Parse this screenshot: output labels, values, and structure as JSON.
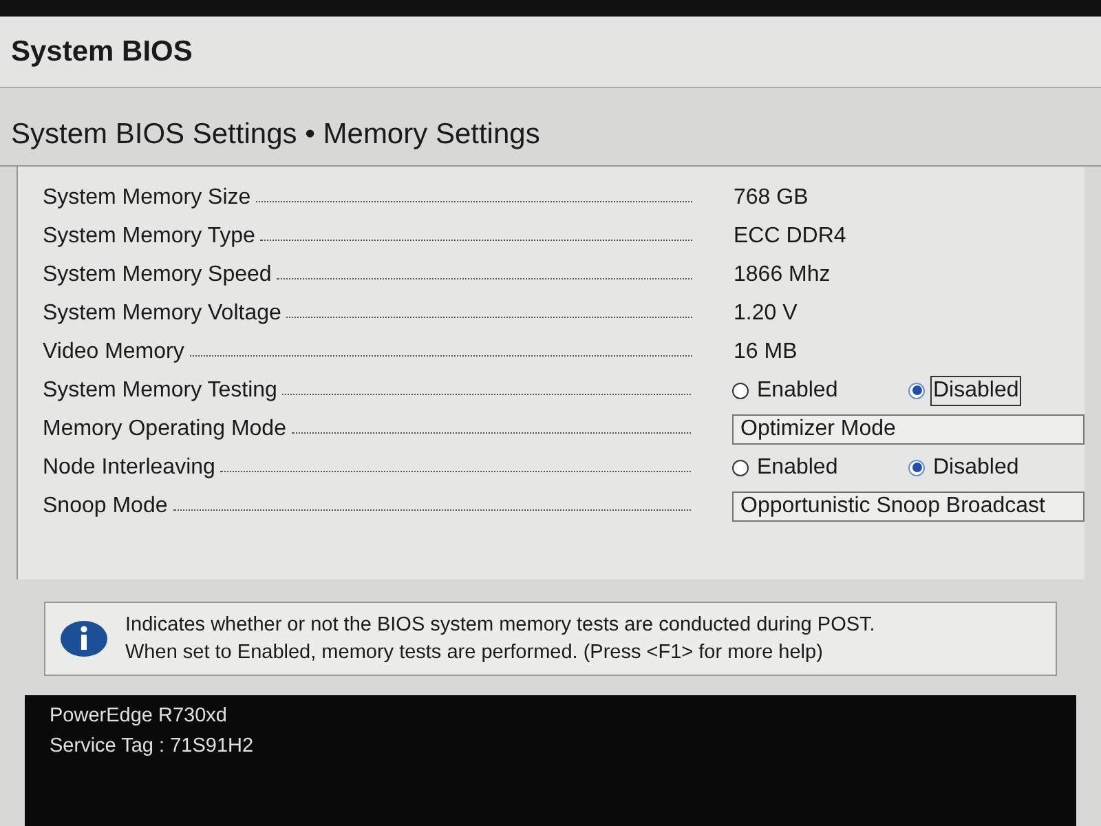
{
  "window": {
    "title": "System BIOS"
  },
  "page": {
    "title": "System BIOS Settings • Memory Settings"
  },
  "settings": [
    {
      "label": "System Memory Size",
      "kind": "value",
      "value": "768 GB"
    },
    {
      "label": "System Memory Type",
      "kind": "value",
      "value": "ECC DDR4"
    },
    {
      "label": "System Memory Speed",
      "kind": "value",
      "value": "1866 Mhz"
    },
    {
      "label": "System Memory Voltage",
      "kind": "value",
      "value": "1.20 V"
    },
    {
      "label": "Video Memory",
      "kind": "value",
      "value": "16 MB"
    },
    {
      "label": "System Memory Testing",
      "kind": "radio",
      "options": [
        {
          "label": "Enabled",
          "selected": false,
          "focused": false
        },
        {
          "label": "Disabled",
          "selected": true,
          "focused": true
        }
      ]
    },
    {
      "label": "Memory Operating Mode",
      "kind": "select",
      "value": "Optimizer Mode"
    },
    {
      "label": "Node Interleaving",
      "kind": "radio",
      "options": [
        {
          "label": "Enabled",
          "selected": false,
          "focused": false
        },
        {
          "label": "Disabled",
          "selected": true,
          "focused": false
        }
      ]
    },
    {
      "label": "Snoop Mode",
      "kind": "select",
      "value": "Opportunistic Snoop Broadcast"
    }
  ],
  "help": {
    "lines": [
      "Indicates whether or not the BIOS system memory tests are conducted during POST.",
      "When set to Enabled, memory tests are performed. (Press <F1> for more help)"
    ]
  },
  "footer": {
    "model": "PowerEdge R730xd",
    "service_tag": "Service Tag : 71S91H2"
  }
}
